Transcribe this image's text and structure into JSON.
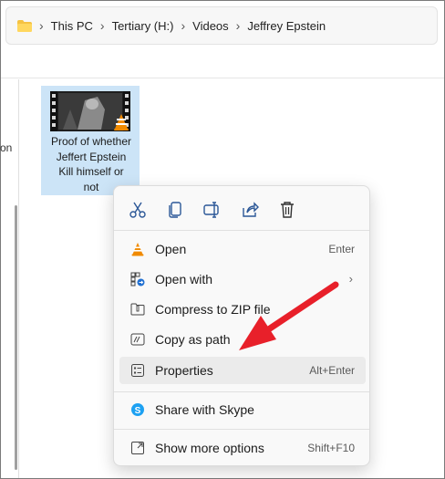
{
  "breadcrumb": {
    "items": [
      "This PC",
      "Tertiary (H:)",
      "Videos",
      "Jeffrey Epstein"
    ]
  },
  "nav_pane": {
    "partial_text": "on"
  },
  "file": {
    "name": "Proof of whether Jeffert Epstein Kill himself or not",
    "name_lines": [
      "Proof of whether",
      "Jeffert Epstein",
      "Kill himself or",
      "not"
    ]
  },
  "context_menu": {
    "quick_actions": [
      "cut-icon",
      "copy-icon",
      "rename-icon",
      "share-icon",
      "delete-icon"
    ],
    "items": [
      {
        "label": "Open",
        "shortcut": "Enter",
        "icon": "vlc-icon"
      },
      {
        "label": "Open with",
        "shortcut": "",
        "icon": "open-with-icon",
        "has_submenu": true
      },
      {
        "label": "Compress to ZIP file",
        "shortcut": "",
        "icon": "zip-icon"
      },
      {
        "label": "Copy as path",
        "shortcut": "",
        "icon": "copy-path-icon"
      },
      {
        "label": "Properties",
        "shortcut": "Alt+Enter",
        "icon": "properties-icon",
        "highlighted": true
      },
      {
        "label": "Share with Skype",
        "shortcut": "",
        "icon": "skype-icon"
      },
      {
        "label": "Show more options",
        "shortcut": "Shift+F10",
        "icon": "more-options-icon"
      }
    ]
  },
  "colors": {
    "selection": "#cce4f7",
    "arrow": "#e8202a",
    "skype": "#1da1f2",
    "vlc": "#f08a00"
  }
}
